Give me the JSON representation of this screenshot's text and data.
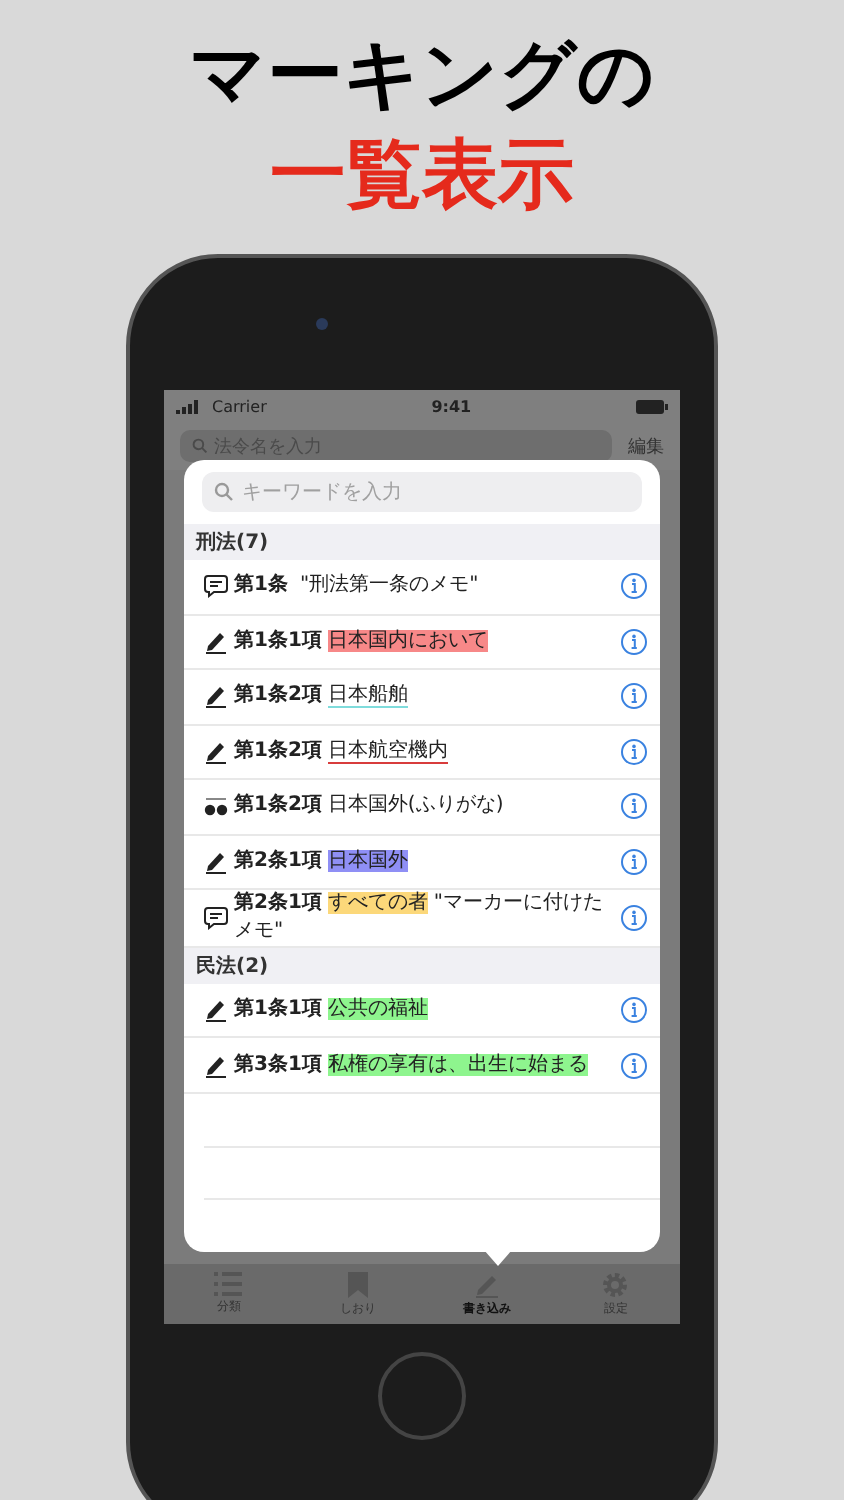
{
  "headline": {
    "line1": "マーキングの",
    "line2": "一覧表示"
  },
  "status_bar": {
    "carrier": "Carrier",
    "time": "9:41"
  },
  "background_screen": {
    "search_placeholder": "法令名を入力",
    "edit": "編集"
  },
  "popover": {
    "search_placeholder": "キーワードを入力",
    "sections": [
      {
        "title": "刑法(7)",
        "items": [
          {
            "kind": "memo",
            "article": "第1条",
            "memo": "\"刑法第一条のメモ\""
          },
          {
            "kind": "highlight",
            "article": "第1条1項",
            "text": "日本国内において",
            "color": "#f78888"
          },
          {
            "kind": "underline",
            "article": "第1条2項",
            "text": "日本船舶",
            "color": "#7fdcdc"
          },
          {
            "kind": "underline",
            "article": "第1条2項",
            "text": "日本航空機内",
            "color": "#d83c3c"
          },
          {
            "kind": "furigana",
            "article": "第1条2項",
            "text": "日本国外(ふりがな)"
          },
          {
            "kind": "highlight",
            "article": "第2条1項",
            "text": "日本国外",
            "color": "#8f8ff5"
          },
          {
            "kind": "memo",
            "article": "第2条1項",
            "text": "すべての者",
            "color": "#fcd87a",
            "memo": "\"マーカーに付けたメモ\""
          }
        ]
      },
      {
        "title": "民法(2)",
        "items": [
          {
            "kind": "highlight",
            "article": "第1条1項",
            "text": "公共の福祉",
            "color": "#8ef58e"
          },
          {
            "kind": "highlight",
            "article": "第3条1項",
            "text": "私権の享有は、出生に始まる",
            "color": "#8ef58e"
          }
        ]
      }
    ]
  },
  "tab_bar": [
    {
      "label": "分類",
      "selected": false
    },
    {
      "label": "しおり",
      "selected": false
    },
    {
      "label": "書き込み",
      "selected": true
    },
    {
      "label": "設定",
      "selected": false
    }
  ]
}
